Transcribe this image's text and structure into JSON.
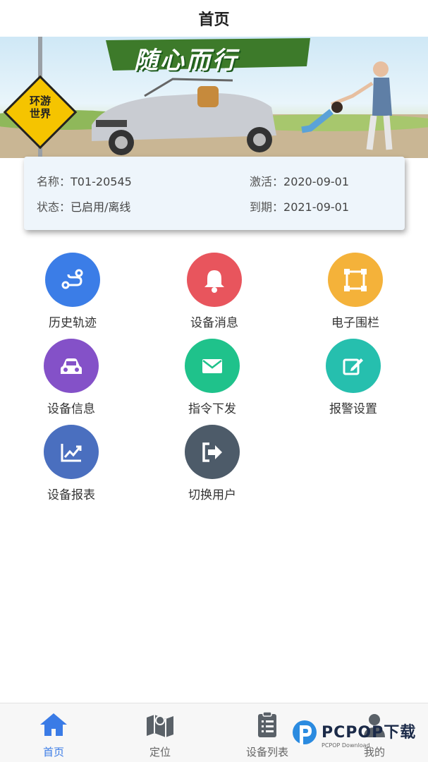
{
  "header": {
    "title": "首页"
  },
  "banner": {
    "slogan": "随心而行",
    "sign_line1": "环游",
    "sign_line2": "世界"
  },
  "device": {
    "name_label": "名称：",
    "name_value": "T01-20545",
    "status_label": "状态：",
    "status_value": "已启用/离线",
    "activate_label": "激活：",
    "activate_value": "2020-09-01",
    "expire_label": "到期：",
    "expire_value": "2021-09-01"
  },
  "menu": [
    {
      "label": "历史轨迹",
      "icon": "route-icon",
      "color": "#3b7de7"
    },
    {
      "label": "设备消息",
      "icon": "bell-icon",
      "color": "#e8555d"
    },
    {
      "label": "电子围栏",
      "icon": "fence-icon",
      "color": "#f4b23a"
    },
    {
      "label": "设备信息",
      "icon": "car-icon",
      "color": "#8451c8"
    },
    {
      "label": "指令下发",
      "icon": "envelope-icon",
      "color": "#1fc28b"
    },
    {
      "label": "报警设置",
      "icon": "edit-icon",
      "color": "#26bfae"
    },
    {
      "label": "设备报表",
      "icon": "chart-icon",
      "color": "#4a6fbf"
    },
    {
      "label": "切换用户",
      "icon": "switch-user-icon",
      "color": "#4d5b69"
    }
  ],
  "tabs": [
    {
      "label": "首页",
      "icon": "home-icon",
      "active": true
    },
    {
      "label": "定位",
      "icon": "map-icon",
      "active": false
    },
    {
      "label": "设备列表",
      "icon": "clipboard-list-icon",
      "active": false
    },
    {
      "label": "我的",
      "icon": "user-icon",
      "active": false
    }
  ],
  "watermark": {
    "brand": "PCPOP下载",
    "sub": "PCPOP Download"
  },
  "colors": {
    "active_tab": "#3a7be6",
    "card_bg": "#eef5fb"
  }
}
